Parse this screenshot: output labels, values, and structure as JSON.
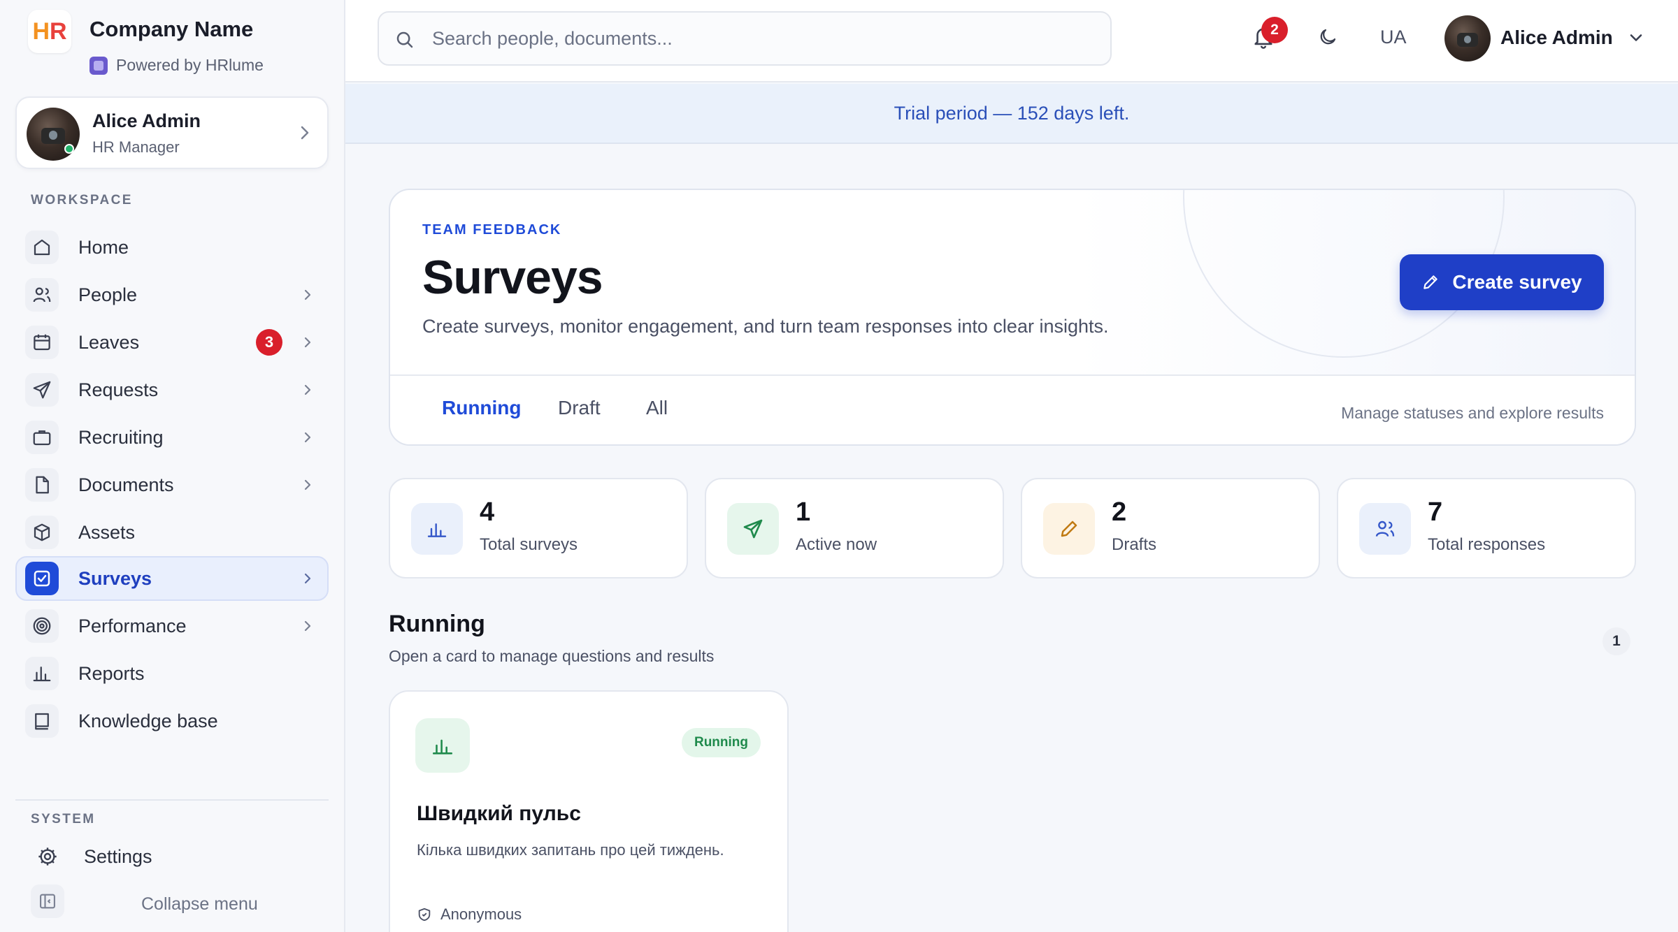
{
  "brand": {
    "logo_h": "H",
    "logo_r": "R",
    "company_name": "Company Name",
    "powered_by": "Powered by HRlume"
  },
  "sidebar": {
    "user": {
      "name": "Alice Admin",
      "role": "HR Manager"
    },
    "workspace_label": "WORKSPACE",
    "items": [
      {
        "label": "Home",
        "icon": "home-icon"
      },
      {
        "label": "People",
        "icon": "users-icon"
      },
      {
        "label": "Leaves",
        "icon": "calendar-icon",
        "badge": "3"
      },
      {
        "label": "Requests",
        "icon": "send-icon"
      },
      {
        "label": "Recruiting",
        "icon": "briefcase-icon"
      },
      {
        "label": "Documents",
        "icon": "document-icon"
      },
      {
        "label": "Assets",
        "icon": "box-icon"
      },
      {
        "label": "Surveys",
        "icon": "checkbox-icon"
      },
      {
        "label": "Performance",
        "icon": "target-icon"
      },
      {
        "label": "Reports",
        "icon": "bar-chart-icon"
      },
      {
        "label": "Knowledge base",
        "icon": "book-icon"
      }
    ],
    "system_label": "SYSTEM",
    "settings_label": "Settings",
    "collapse_label": "Collapse menu"
  },
  "topbar": {
    "search_placeholder": "Search people, documents...",
    "notifications_count": "2",
    "language": "UA",
    "user_name": "Alice Admin"
  },
  "trial_banner": "Trial period — 152 days left.",
  "hero": {
    "eyebrow": "TEAM FEEDBACK",
    "title": "Surveys",
    "subtitle": "Create surveys, monitor engagement, and turn team responses into clear insights.",
    "create_button": "Create survey",
    "tabs": [
      {
        "label": "Running"
      },
      {
        "label": "Draft"
      },
      {
        "label": "All"
      }
    ],
    "tabs_hint": "Manage statuses and explore results"
  },
  "stats": [
    {
      "value": "4",
      "label": "Total surveys",
      "icon": "bar-chart-icon",
      "color": "#eaf0fb"
    },
    {
      "value": "1",
      "label": "Active now",
      "icon": "send-icon",
      "color": "#e6f6ec"
    },
    {
      "value": "2",
      "label": "Drafts",
      "icon": "pencil-icon",
      "color": "#fdf3e3"
    },
    {
      "value": "7",
      "label": "Total responses",
      "icon": "users-icon",
      "color": "#eaf0fb"
    }
  ],
  "running": {
    "title": "Running",
    "subtitle": "Open a card to manage questions and results",
    "count": "1",
    "cards": [
      {
        "title": "Швидкий пульс",
        "description": "Кілька швидких запитань про цей тиждень.",
        "status": "Running",
        "meta": "Anonymous"
      }
    ]
  },
  "colors": {
    "accent": "#1f4bd8",
    "danger": "#d91f2b",
    "success": "#1f8a4c"
  }
}
